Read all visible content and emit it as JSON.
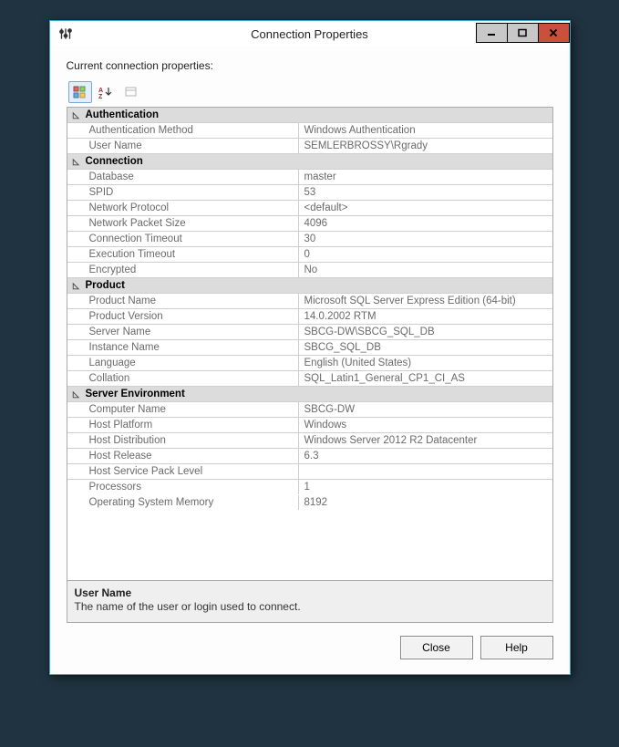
{
  "window": {
    "title": "Connection Properties",
    "label": "Current connection properties:"
  },
  "toolbar": {
    "categorized_name": "categorized-view",
    "alpha_name": "alphabetical-view",
    "pages_name": "property-pages"
  },
  "sections": [
    {
      "title": "Authentication",
      "rows": [
        {
          "k": "Authentication Method",
          "v": "Windows Authentication"
        },
        {
          "k": "User Name",
          "v": "SEMLERBROSSY\\Rgrady"
        }
      ]
    },
    {
      "title": "Connection",
      "rows": [
        {
          "k": "Database",
          "v": "master"
        },
        {
          "k": "SPID",
          "v": "53"
        },
        {
          "k": "Network Protocol",
          "v": "<default>"
        },
        {
          "k": "Network Packet Size",
          "v": "4096"
        },
        {
          "k": "Connection Timeout",
          "v": "30"
        },
        {
          "k": "Execution Timeout",
          "v": "0"
        },
        {
          "k": "Encrypted",
          "v": "No"
        }
      ]
    },
    {
      "title": "Product",
      "rows": [
        {
          "k": "Product Name",
          "v": "Microsoft SQL Server Express Edition (64-bit)"
        },
        {
          "k": "Product Version",
          "v": "14.0.2002 RTM"
        },
        {
          "k": "Server Name",
          "v": "SBCG-DW\\SBCG_SQL_DB"
        },
        {
          "k": "Instance Name",
          "v": "SBCG_SQL_DB"
        },
        {
          "k": "Language",
          "v": "English (United States)"
        },
        {
          "k": "Collation",
          "v": "SQL_Latin1_General_CP1_CI_AS"
        }
      ]
    },
    {
      "title": "Server Environment",
      "rows": [
        {
          "k": "Computer Name",
          "v": "SBCG-DW"
        },
        {
          "k": "Host Platform",
          "v": "Windows"
        },
        {
          "k": "Host Distribution",
          "v": "Windows Server 2012 R2 Datacenter"
        },
        {
          "k": "Host Release",
          "v": "6.3"
        },
        {
          "k": "Host Service Pack Level",
          "v": ""
        },
        {
          "k": "Processors",
          "v": "1"
        },
        {
          "k": "Operating System Memory",
          "v": "8192"
        }
      ]
    }
  ],
  "description": {
    "name": "User Name",
    "text": "The name of the user or login used to connect."
  },
  "buttons": {
    "close": "Close",
    "help": "Help"
  }
}
